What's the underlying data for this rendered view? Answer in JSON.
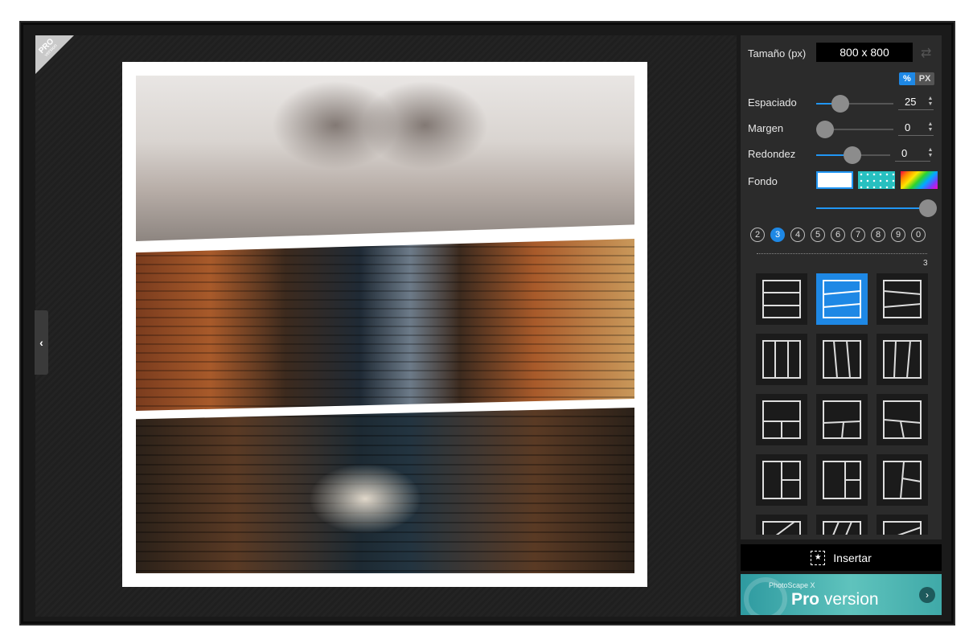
{
  "app": {
    "badge": "PRO",
    "badge_sub": "version"
  },
  "collage": {
    "photos": [
      "books heart",
      "library reading",
      "floating book"
    ]
  },
  "panel": {
    "size_label": "Tamaño (px)",
    "size_value": "800 x 800",
    "unit_percent": "%",
    "unit_px": "PX",
    "spacing": {
      "label": "Espaciado",
      "value": "25",
      "fraction": 0.17
    },
    "margin": {
      "label": "Margen",
      "value": "0",
      "fraction": 0.0
    },
    "rounding": {
      "label": "Redondez",
      "value": "0",
      "fraction": 0.34
    },
    "background": {
      "label": "Fondo",
      "opacity_fraction": 1.0
    },
    "counts": [
      "2",
      "3",
      "4",
      "5",
      "6",
      "7",
      "8",
      "9",
      "0"
    ],
    "active_count": "3",
    "selected_count_label": "3"
  },
  "insert_label": "Insertar",
  "pro": {
    "small": "PhotoScape X",
    "pro": "Pro",
    "version": " version"
  },
  "colors": {
    "accent": "#1e88e5",
    "panel": "#2b2b2b",
    "teal": "#4bb8b4"
  }
}
